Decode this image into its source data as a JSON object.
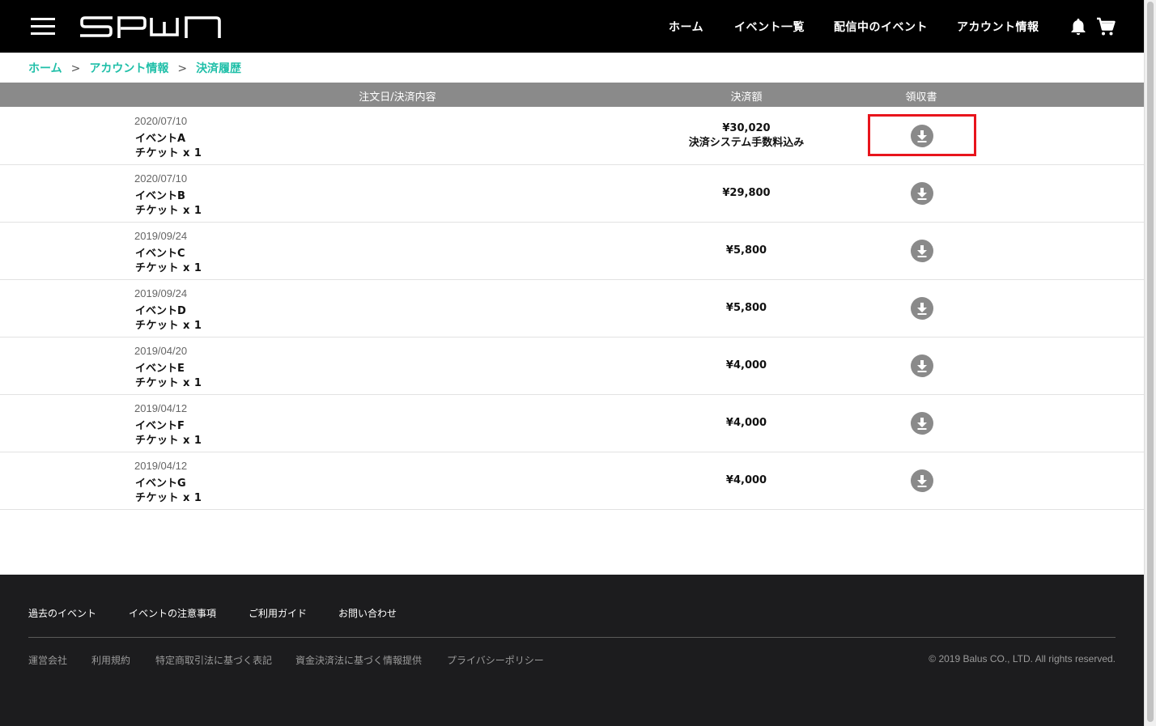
{
  "brand": {
    "logo_text": "SPWN",
    "accent": "#1fbfa8",
    "highlight": "#e8141c"
  },
  "nav": {
    "home": "ホーム",
    "events": "イベント一覧",
    "live": "配信中のイベント",
    "account": "アカウント情報"
  },
  "breadcrumb": {
    "home": "ホーム",
    "account": "アカウント情報",
    "current": "決済履歴",
    "separator": ">"
  },
  "table": {
    "headers": {
      "order": "注文日/決済内容",
      "amount": "決済額",
      "receipt": "領収書"
    },
    "rows": [
      {
        "date": "2020/07/10",
        "event": "イベントA",
        "ticket": "チケット x 1",
        "amount": "¥30,020",
        "note": "決済システム手数料込み"
      },
      {
        "date": "2020/07/10",
        "event": "イベントB",
        "ticket": "チケット x 1",
        "amount": "¥29,800"
      },
      {
        "date": "2019/09/24",
        "event": "イベントC",
        "ticket": "チケット x 1",
        "amount": "¥5,800"
      },
      {
        "date": "2019/09/24",
        "event": "イベントD",
        "ticket": "チケット x 1",
        "amount": "¥5,800"
      },
      {
        "date": "2019/04/20",
        "event": "イベントE",
        "ticket": "チケット x 1",
        "amount": "¥4,000"
      },
      {
        "date": "2019/04/12",
        "event": "イベントF",
        "ticket": "チケット x 1",
        "amount": "¥4,000"
      },
      {
        "date": "2019/04/12",
        "event": "イベントG",
        "ticket": "チケット x 1",
        "amount": "¥4,000"
      }
    ]
  },
  "footer": {
    "links": [
      "過去のイベント",
      "イベントの注意事項",
      "ご利用ガイド",
      "お問い合わせ"
    ],
    "sublinks": [
      "運営会社",
      "利用規約",
      "特定商取引法に基づく表記",
      "資金決済法に基づく情報提供",
      "プライバシーポリシー"
    ],
    "copyright": "© 2019 Balus CO., LTD. All rights reserved."
  }
}
